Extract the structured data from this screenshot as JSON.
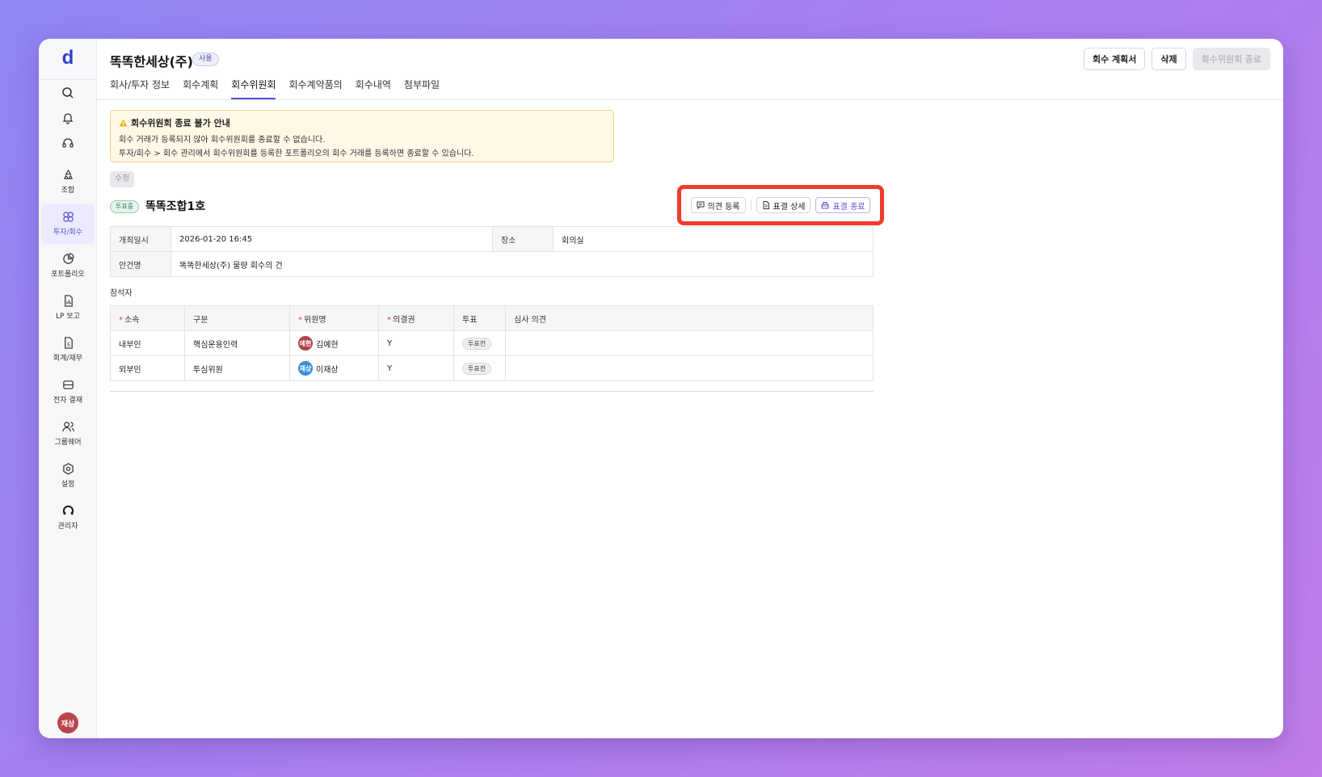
{
  "colors": {
    "accent": "#5a4fd6",
    "highlight_box": "#ee3b2f",
    "notice_bg": "#fff8e6"
  },
  "sidebar": {
    "logo": "d",
    "top_icons": [
      "search-icon",
      "bell-icon",
      "headset-icon"
    ],
    "items": [
      {
        "label": "조합",
        "icon": "recycle-icon"
      },
      {
        "label": "투자/회수",
        "icon": "investment-icon",
        "active": true
      },
      {
        "label": "포트폴리오",
        "icon": "pie-chart-icon"
      },
      {
        "label": "LP 보고",
        "icon": "report-icon"
      },
      {
        "label": "회계/재무",
        "icon": "finance-icon"
      },
      {
        "label": "전자 결재",
        "icon": "inbox-icon"
      },
      {
        "label": "그룹웨어",
        "icon": "users-icon"
      },
      {
        "label": "설정",
        "icon": "settings-icon"
      },
      {
        "label": "관리자",
        "icon": "admin-icon"
      }
    ],
    "user_avatar": "재상"
  },
  "header": {
    "title": "똑똑한세상(주)",
    "status": "사용",
    "actions": {
      "plan": "회수 계획서",
      "delete": "삭제",
      "close_committee": "회수위원회 종료"
    }
  },
  "tabs": [
    "회사/투자 정보",
    "회수계획",
    "회수위원회",
    "회수계약품의",
    "회수내역",
    "첨부파일"
  ],
  "active_tab": "회수위원회",
  "notice": {
    "title": "회수위원회 종료 불가 안내",
    "line1": "회수 거래가 등록되지 않아 회수위원회를 종료할 수 없습니다.",
    "line2": "투자/회수 > 회수 관리에서 회수위원회를 등록한 포트폴리오의 회수 거래를 등록하면 종료할 수 있습니다."
  },
  "edit_label": "수정",
  "fund": {
    "badge": "투표중",
    "name": "똑똑조합1호"
  },
  "vote_actions": {
    "opinion": "의견 등록",
    "detail": "표결 상세",
    "close": "표결 종료"
  },
  "meeting": {
    "date_label": "개최일시",
    "date": "2026-01-20 16:45",
    "place_label": "장소",
    "place": "회의실",
    "agenda_label": "안건명",
    "agenda": "똑똑한세상(주) 물량 회수의 건"
  },
  "attendees_label": "참석자",
  "attendees_table": {
    "headers": {
      "affiliation": "소속",
      "type": "구분",
      "member": "위원명",
      "voting_right": "의결권",
      "vote": "투표",
      "opinion": "심사 의견"
    },
    "rows": [
      {
        "affiliation": "내부인",
        "type": "핵심운용인력",
        "avatar": "예현",
        "avatar_color": "#b0434a",
        "member": "김예현",
        "voting_right": "Y",
        "vote": "투표전",
        "opinion": ""
      },
      {
        "affiliation": "외부인",
        "type": "투심위원",
        "avatar": "재상",
        "avatar_color": "#3a8fd8",
        "member": "이재상",
        "voting_right": "Y",
        "vote": "투표전",
        "opinion": ""
      }
    ]
  }
}
